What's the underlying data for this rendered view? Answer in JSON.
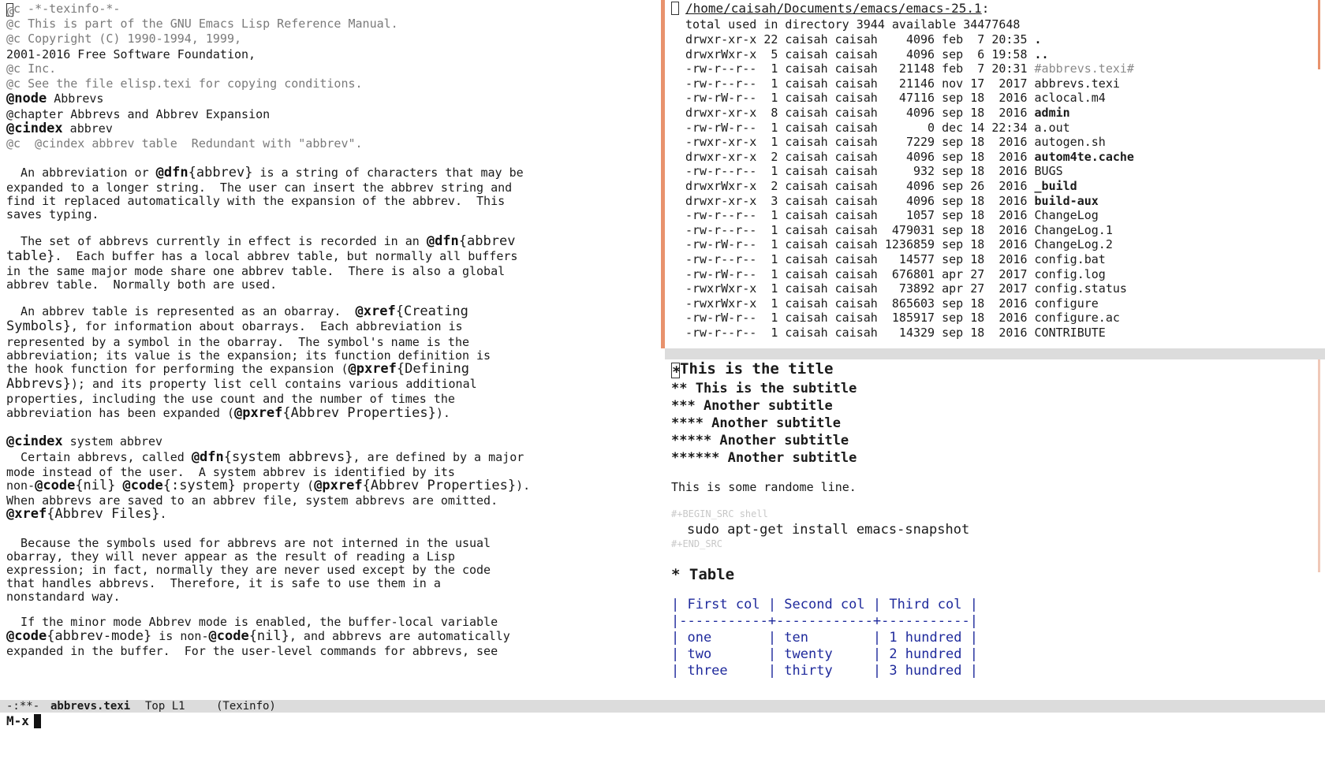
{
  "left_pane": {
    "header_lines": [
      {
        "text": "c -*-texinfo-*-",
        "style": "cm"
      },
      {
        "text": "@c This is part of the GNU Emacs Lisp Reference Manual.",
        "style": "cm"
      },
      {
        "text": "@c Copyright (C) 1990-1994, 1999,",
        "style": "cm"
      },
      {
        "text": "2001-2016 Free Software Foundation,",
        "style": "plain"
      },
      {
        "text": "@c Inc.",
        "style": "cm"
      },
      {
        "text": "@c See the file elisp.texi for copying conditions.",
        "style": "cm"
      }
    ],
    "node_kw": "@node",
    "node_val": " Abbrevs",
    "chapter": "@chapter Abbrevs and Abbrev Expansion",
    "cindex1_kw": "@cindex",
    "cindex1_val": " abbrev",
    "comment2": "@c  @cindex abbrev table  Redundant with \"abbrev\".",
    "p1": [
      "  An abbreviation or ",
      "@dfn",
      "{abbrev}",
      " is a string of characters that may be",
      "expanded to a longer string.  The user can insert the abbrev string and",
      "find it replaced automatically with the expansion of the abbrev.  This",
      "saves typing."
    ],
    "p2": [
      "  The set of abbrevs currently in effect is recorded in an ",
      "@dfn",
      "{abbrev",
      "table}",
      ".  Each buffer has a local abbrev table, but normally all buffers",
      "in the same major mode share one abbrev table.  There is also a global",
      "abbrev table.  Normally both are used."
    ],
    "p3": [
      "  An abbrev table is represented as an obarray.  ",
      "@xref",
      "{Creating",
      "Symbols}",
      ", for information about obarrays.  Each abbreviation is",
      "represented by a symbol in the obarray.  The symbol's name is the",
      "abbreviation; its value is the expansion; its function definition is",
      "the hook function for performing the expansion (",
      "@pxref",
      "{Defining",
      "Abbrevs}",
      "); and its property list cell contains various additional",
      "properties, including the use count and the number of times the",
      "abbreviation has been expanded (",
      "@pxref",
      "{Abbrev Properties}",
      ")."
    ],
    "cindex2_kw": "@cindex",
    "cindex2_val": " system abbrev",
    "p4": [
      "  Certain abbrevs, called ",
      "@dfn",
      "{system abbrevs}",
      ", are defined by a major",
      "mode instead of the user.  A system abbrev is identified by its",
      "non-",
      "@code",
      "{nil}",
      " ",
      "@code",
      "{:system}",
      " property (",
      "@pxref",
      "{Abbrev Properties}",
      ").",
      "When abbrevs are saved to an abbrev file, system abbrevs are omitted.",
      "@xref",
      "{Abbrev Files}",
      "."
    ],
    "p5": [
      "  Because the symbols used for abbrevs are not interned in the usual",
      "obarray, they will never appear as the result of reading a Lisp",
      "expression; in fact, normally they are never used except by the code",
      "that handles abbrevs.  Therefore, it is safe to use them in a",
      "nonstandard way."
    ],
    "p6": [
      "  If the minor mode Abbrev mode is enabled, the buffer-local variable",
      "@code",
      "{abbrev-mode}",
      " is non-",
      "@code",
      "{nil}",
      ", and abbrevs are automatically",
      "expanded in the buffer.  For the user-level commands for abbrevs, see"
    ]
  },
  "dired": {
    "path": "/home/caisah/Documents/emacs/emacs-25.1",
    "colon": ":",
    "summary": "total used in directory 3944 available 34477648",
    "rows": [
      {
        "perm": "drwxr-xr-x",
        "links": "22",
        "owner": "caisah",
        "group": "caisah",
        "size": "4096",
        "date": "feb  7 20:35",
        "name": ".",
        "style": "bold"
      },
      {
        "perm": "drwxrWxr-x",
        "links": " 5",
        "owner": "caisah",
        "group": "caisah",
        "size": "4096",
        "date": "sep  6 19:58",
        "name": "..",
        "style": "bold"
      },
      {
        "perm": "-rw-r--r--",
        "links": " 1",
        "owner": "caisah",
        "group": "caisah",
        "size": "21148",
        "date": "feb  7 20:31",
        "name": "#abbrevs.texi#",
        "style": "auto"
      },
      {
        "perm": "-rw-r--r--",
        "links": " 1",
        "owner": "caisah",
        "group": "caisah",
        "size": "21146",
        "date": "nov 17  2017",
        "name": "abbrevs.texi",
        "style": "plain"
      },
      {
        "perm": "-rw-rW-r--",
        "links": " 1",
        "owner": "caisah",
        "group": "caisah",
        "size": "47116",
        "date": "sep 18  2016",
        "name": "aclocal.m4",
        "style": "plain"
      },
      {
        "perm": "drwxr-xr-x",
        "links": " 8",
        "owner": "caisah",
        "group": "caisah",
        "size": "4096",
        "date": "sep 18  2016",
        "name": "admin",
        "style": "bold"
      },
      {
        "perm": "-rw-rW-r--",
        "links": " 1",
        "owner": "caisah",
        "group": "caisah",
        "size": "0",
        "date": "dec 14 22:34",
        "name": "a.out",
        "style": "plain"
      },
      {
        "perm": "-rwxr-xr-x",
        "links": " 1",
        "owner": "caisah",
        "group": "caisah",
        "size": "7229",
        "date": "sep 18  2016",
        "name": "autogen.sh",
        "style": "plain"
      },
      {
        "perm": "drwxr-xr-x",
        "links": " 2",
        "owner": "caisah",
        "group": "caisah",
        "size": "4096",
        "date": "sep 18  2016",
        "name": "autom4te.cache",
        "style": "bold"
      },
      {
        "perm": "-rw-r--r--",
        "links": " 1",
        "owner": "caisah",
        "group": "caisah",
        "size": "932",
        "date": "sep 18  2016",
        "name": "BUGS",
        "style": "plain"
      },
      {
        "perm": "drwxrWxr-x",
        "links": " 2",
        "owner": "caisah",
        "group": "caisah",
        "size": "4096",
        "date": "sep 26  2016",
        "name": "_build",
        "style": "bold"
      },
      {
        "perm": "drwxr-xr-x",
        "links": " 3",
        "owner": "caisah",
        "group": "caisah",
        "size": "4096",
        "date": "sep 18  2016",
        "name": "build-aux",
        "style": "bold"
      },
      {
        "perm": "-rw-r--r--",
        "links": " 1",
        "owner": "caisah",
        "group": "caisah",
        "size": "1057",
        "date": "sep 18  2016",
        "name": "ChangeLog",
        "style": "plain"
      },
      {
        "perm": "-rw-r--r--",
        "links": " 1",
        "owner": "caisah",
        "group": "caisah",
        "size": "479031",
        "date": "sep 18  2016",
        "name": "ChangeLog.1",
        "style": "plain"
      },
      {
        "perm": "-rw-rW-r--",
        "links": " 1",
        "owner": "caisah",
        "group": "caisah",
        "size": "1236859",
        "date": "sep 18  2016",
        "name": "ChangeLog.2",
        "style": "plain"
      },
      {
        "perm": "-rw-r--r--",
        "links": " 1",
        "owner": "caisah",
        "group": "caisah",
        "size": "14577",
        "date": "sep 18  2016",
        "name": "config.bat",
        "style": "plain"
      },
      {
        "perm": "-rw-rW-r--",
        "links": " 1",
        "owner": "caisah",
        "group": "caisah",
        "size": "676801",
        "date": "apr 27  2017",
        "name": "config.log",
        "style": "plain"
      },
      {
        "perm": "-rwxrWxr-x",
        "links": " 1",
        "owner": "caisah",
        "group": "caisah",
        "size": "73892",
        "date": "apr 27  2017",
        "name": "config.status",
        "style": "plain"
      },
      {
        "perm": "-rwxrWxr-x",
        "links": " 1",
        "owner": "caisah",
        "group": "caisah",
        "size": "865603",
        "date": "sep 18  2016",
        "name": "configure",
        "style": "plain"
      },
      {
        "perm": "-rw-rW-r--",
        "links": " 1",
        "owner": "caisah",
        "group": "caisah",
        "size": "185917",
        "date": "sep 18  2016",
        "name": "configure.ac",
        "style": "plain"
      },
      {
        "perm": "-rw-r--r--",
        "links": " 1",
        "owner": "caisah",
        "group": "caisah",
        "size": "14329",
        "date": "sep 18  2016",
        "name": "CONTRIBUTE",
        "style": "plain"
      }
    ]
  },
  "org": {
    "h1_stars": "* ",
    "h1": "This is the title",
    "h2": "** This is the subtitle",
    "h3": "*** Another subtitle",
    "h4": "**** Another subtitle",
    "h5": "***** Another subtitle",
    "h6": "****** Another subtitle",
    "line": "This is some randome line.",
    "begin_src": "#+BEGIN_SRC shell",
    "src": "sudo apt-get install emacs-snapshot",
    "end_src": "#+END_SRC",
    "table_heading": "* Table",
    "table_lines": [
      "| First col | Second col | Third col |",
      "|-----------+------------+-----------|",
      "| one       | ten        | 1 hundred |",
      "| two       | twenty     | 2 hundred |",
      "| three     | thirty     | 3 hundred |"
    ]
  },
  "modeline": {
    "status": "-:**-",
    "buffer": "abbrevs.texi",
    "position": "Top L1",
    "mode": "(Texinfo)"
  },
  "minibuffer": {
    "prompt": "M-x"
  },
  "colors": {
    "accent": "#e8926d",
    "table": "#1f2a9c",
    "comment": "#7a7a7a"
  }
}
